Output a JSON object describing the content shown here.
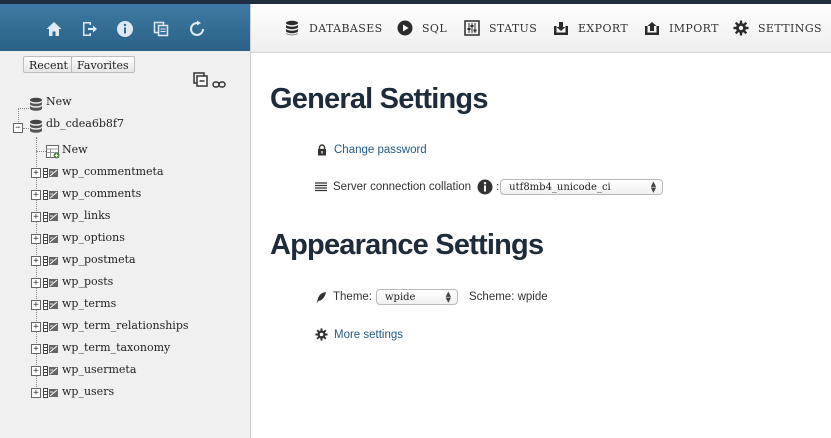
{
  "nav": {
    "header_icons": [
      "home-icon",
      "logout-icon",
      "info-icon",
      "copy-icon",
      "reload-icon"
    ],
    "tabs": {
      "recent": "Recent",
      "favorites": "Favorites"
    },
    "tree": {
      "new_label": "New",
      "database": "db_cdea6b8f7",
      "table_new_label": "New",
      "tables": [
        "wp_commentmeta",
        "wp_comments",
        "wp_links",
        "wp_options",
        "wp_postmeta",
        "wp_posts",
        "wp_terms",
        "wp_term_relationships",
        "wp_term_taxonomy",
        "wp_usermeta",
        "wp_users"
      ]
    }
  },
  "menubar": {
    "items": [
      {
        "label": "DATABASES",
        "icon": "database-icon"
      },
      {
        "label": "SQL",
        "icon": "play-icon"
      },
      {
        "label": "STATUS",
        "icon": "sliders-icon"
      },
      {
        "label": "EXPORT",
        "icon": "export-icon"
      },
      {
        "label": "IMPORT",
        "icon": "import-icon"
      },
      {
        "label": "SETTINGS",
        "icon": "gear-icon"
      }
    ]
  },
  "general": {
    "title": "General Settings",
    "change_password": "Change password",
    "collation_label": "Server connection collation",
    "collation_value": "utf8mb4_unicode_ci"
  },
  "appearance": {
    "title": "Appearance Settings",
    "theme_label": "Theme:",
    "theme_value": "wpide",
    "scheme_label": "Scheme: wpide",
    "more_settings": "More settings"
  },
  "colors": {
    "nav_header": "#2b6186",
    "link": "#235a81",
    "heading": "#1d2b3a"
  }
}
